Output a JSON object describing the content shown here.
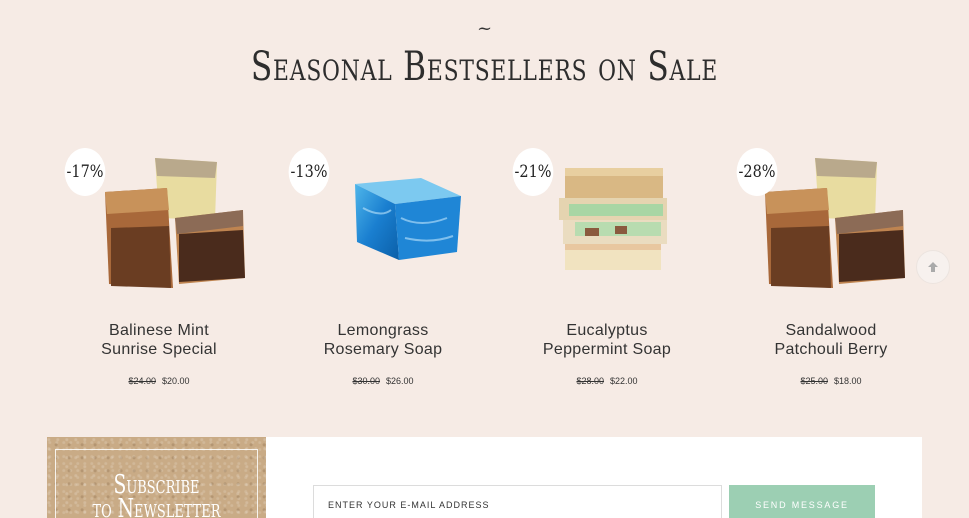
{
  "section": {
    "ornament": "~",
    "title": "Seasonal Bestsellers on Sale"
  },
  "products": [
    {
      "discount": "-17%",
      "name_line1": "Balinese Mint",
      "name_line2": "Sunrise Special",
      "old_price": "$24.00",
      "price": "$20.00",
      "image_icon": "layered-soap-chunks-image"
    },
    {
      "discount": "-13%",
      "name_line1": "Lemongrass",
      "name_line2": "Rosemary Soap",
      "old_price": "$30.00",
      "price": "$26.00",
      "image_icon": "blue-soap-bar-image"
    },
    {
      "discount": "-21%",
      "name_line1": "Eucalyptus",
      "name_line2": "Peppermint Soap",
      "old_price": "$28.00",
      "price": "$22.00",
      "image_icon": "stacked-soap-bars-image"
    },
    {
      "discount": "-28%",
      "name_line1": "Sandalwood",
      "name_line2": "Patchouli Berry",
      "old_price": "$25.00",
      "price": "$18.00",
      "image_icon": "layered-soap-chunks-image"
    }
  ],
  "scroll_top": {
    "icon": "arrow-up-icon"
  },
  "newsletter": {
    "title_line1": "Subscribe",
    "title_line2": "to Newsletter",
    "email_placeholder": "ENTER YOUR E-MAIL ADDRESS",
    "button_label": "SEND MESSAGE"
  },
  "colors": {
    "background": "#f6ebe5",
    "button": "#9ccfb3",
    "kraft": "#c9ab86"
  }
}
